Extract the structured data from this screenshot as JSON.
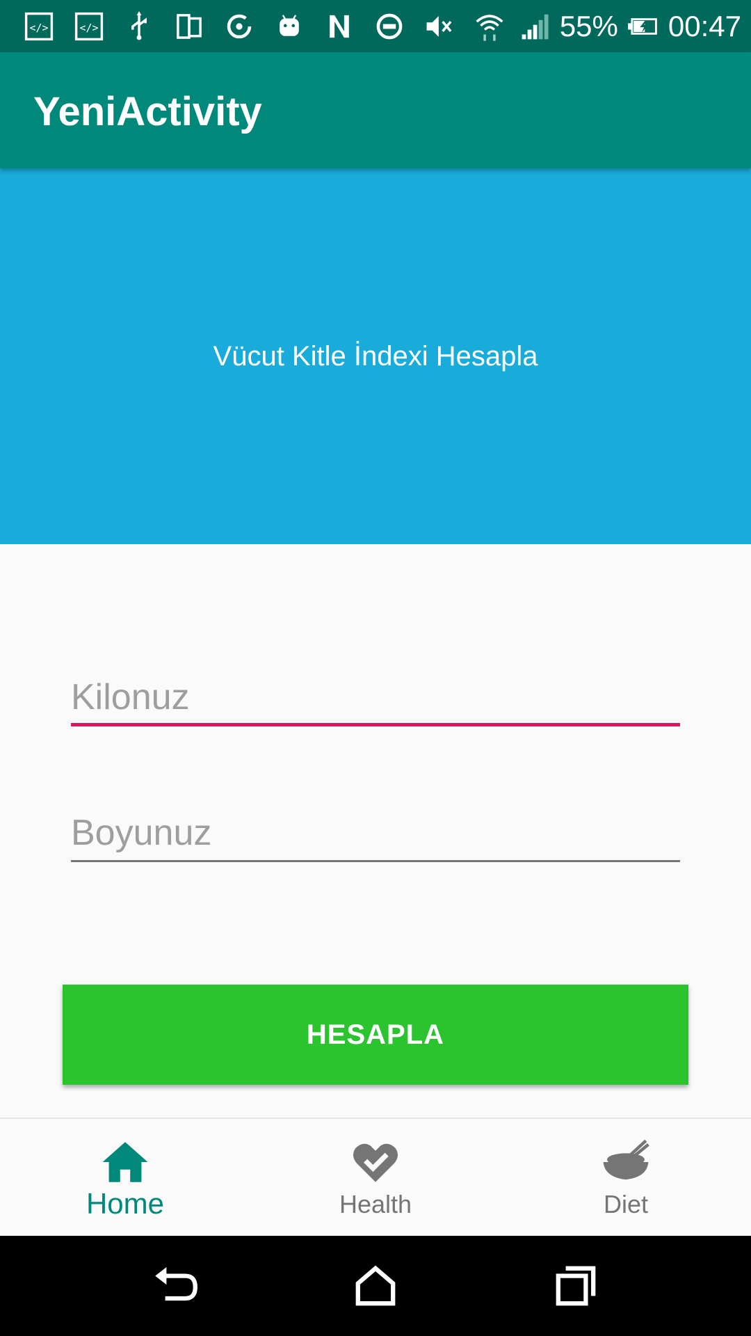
{
  "status_bar": {
    "battery_percent": "55%",
    "time": "00:47",
    "icons": [
      "code-icon",
      "code-icon",
      "usb-icon",
      "phone-rotate-icon",
      "sync-icon",
      "android-icon",
      "nfc-icon",
      "do-not-disturb-icon",
      "mute-icon",
      "wifi-icon",
      "signal-icon",
      "battery-charging-icon"
    ]
  },
  "app_bar": {
    "title": "YeniActivity"
  },
  "banner": {
    "text": "Vücut Kitle İndexi Hesapla"
  },
  "form": {
    "weight_placeholder": "Kilonuz",
    "weight_value": "",
    "height_placeholder": "Boyunuz",
    "height_value": "",
    "submit_label": "HESAPLA"
  },
  "bottom_nav": {
    "items": [
      {
        "label": "Home",
        "icon": "home-icon",
        "active": true
      },
      {
        "label": "Health",
        "icon": "heart-check-icon",
        "active": false
      },
      {
        "label": "Diet",
        "icon": "bowl-icon",
        "active": false
      }
    ]
  },
  "system_nav": {
    "icons": [
      "back-icon",
      "home-icon",
      "recent-apps-icon"
    ]
  },
  "colors": {
    "status_bar": "#00695c",
    "app_bar": "#00897b",
    "banner": "#19acdb",
    "button": "#2bc42f",
    "focus_underline": "#d81b60",
    "active_nav": "#00897b"
  }
}
